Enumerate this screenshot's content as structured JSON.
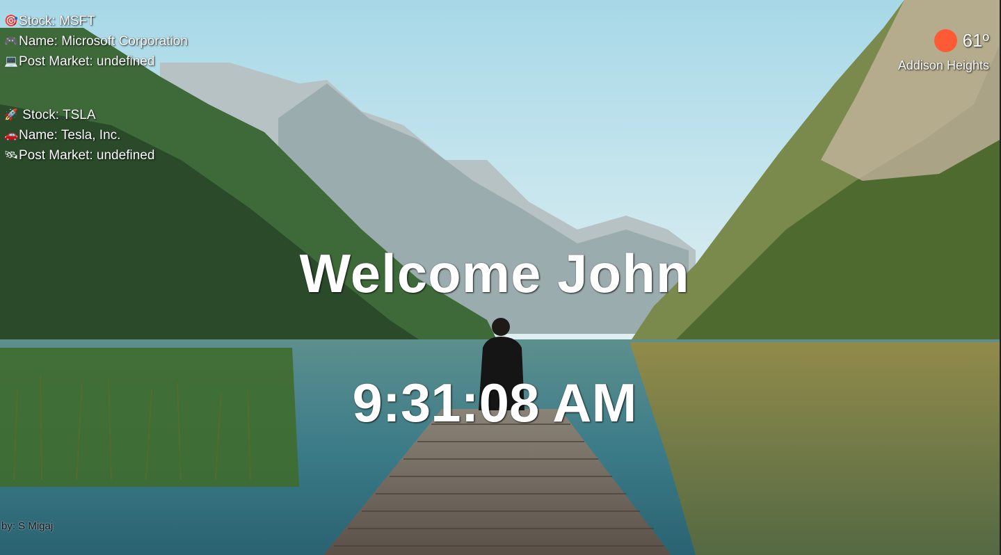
{
  "background": {
    "icon": "mountain-lake-dock-photo",
    "colors": {
      "sky": "#cfe7ee",
      "water": "#3e7a86",
      "forest": "#2f5a2c",
      "dock": "#6f655a"
    }
  },
  "stocks": [
    {
      "symbol_line": "Stock: MSFT",
      "name_line": "Name: Microsoft Corporation",
      "post_market_line": "Post Market: undefined",
      "icons": [
        "target-icon",
        "gamepad-icon",
        "laptop-icon"
      ],
      "glyphs": [
        "🎯",
        "🎮",
        "💻"
      ]
    },
    {
      "symbol_line": " Stock: TSLA",
      "name_line": "Name: Tesla, Inc.",
      "post_market_line": "Post Market: undefined",
      "icons": [
        "rocket-icon",
        "car-icon",
        "satellite-icon"
      ],
      "glyphs": [
        "🚀",
        "🚗",
        "🛰"
      ]
    }
  ],
  "weather": {
    "temperature": "61º",
    "location": "Addison Heights",
    "icon": "sun-icon",
    "icon_color": "#ff5a36"
  },
  "greeting": "Welcome John",
  "clock": "9:31:08 AM",
  "credit": "by: S Migaj"
}
